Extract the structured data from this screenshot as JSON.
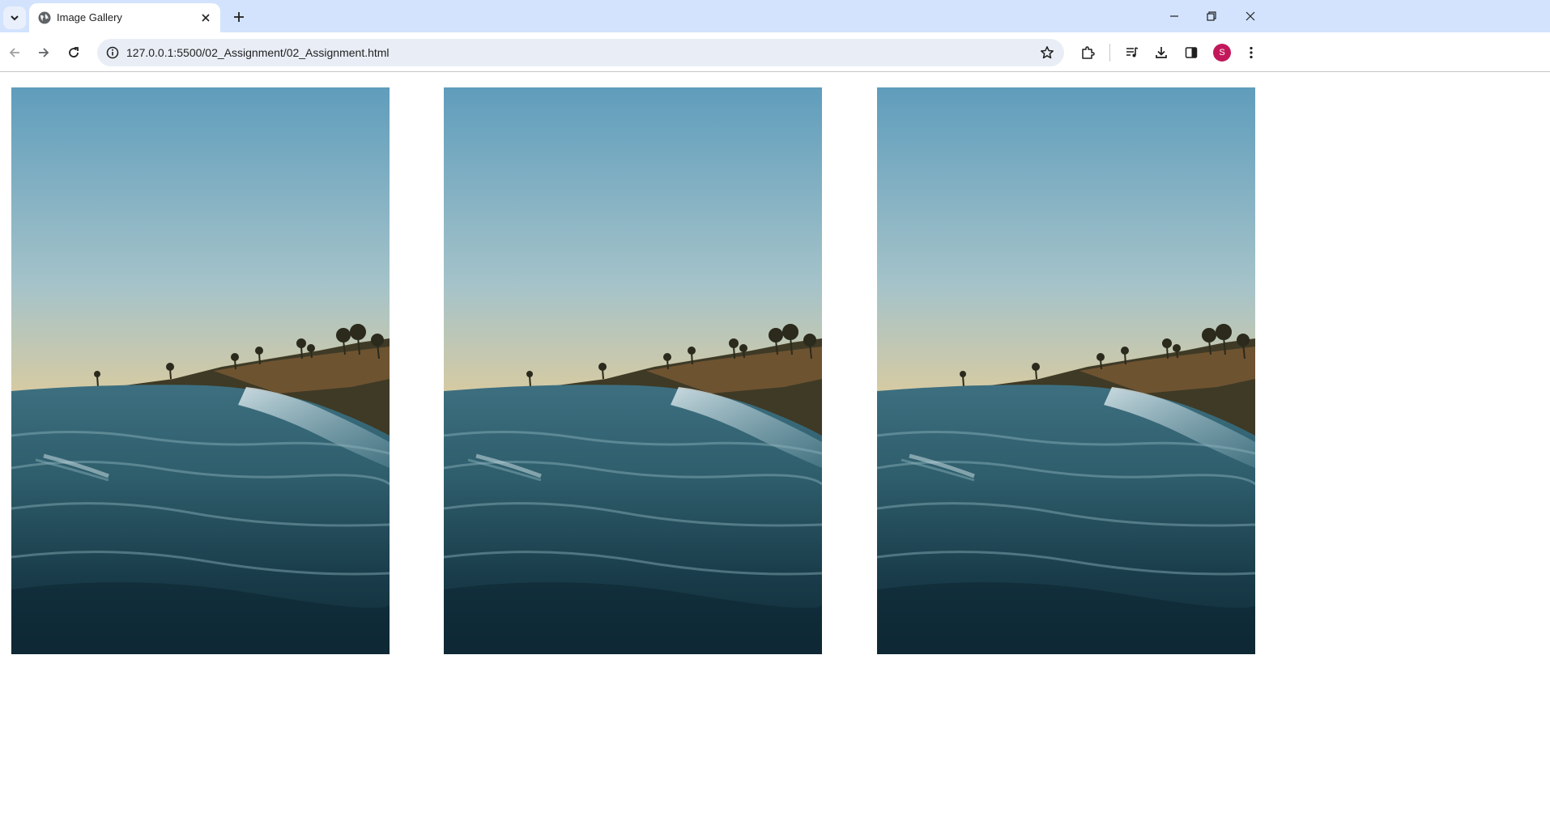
{
  "browser": {
    "tab": {
      "title": "Image Gallery"
    },
    "address_bar": {
      "url": "127.0.0.1:5500/02_Assignment/02_Assignment.html"
    },
    "profile": {
      "initial": "S",
      "color": "#c2185b"
    }
  },
  "icons": {
    "tab_search": "chevron-down-icon",
    "favicon": "globe-icon",
    "tab_close": "close-icon",
    "new_tab": "plus-icon",
    "back": "arrow-left-icon",
    "forward": "arrow-right-icon",
    "reload": "reload-icon",
    "site_info": "info-icon",
    "bookmark": "star-icon",
    "extensions": "puzzle-icon",
    "media": "media-controls-icon",
    "downloads": "download-icon",
    "side_panel": "side-panel-icon",
    "menu": "more-vert-icon",
    "minimize": "minimize-icon",
    "restore": "restore-icon",
    "close_window": "close-icon"
  },
  "gallery": {
    "images": [
      {
        "subject": "wave-at-sunset-photo"
      },
      {
        "subject": "wave-at-sunset-photo"
      },
      {
        "subject": "wave-at-sunset-photo"
      }
    ]
  }
}
